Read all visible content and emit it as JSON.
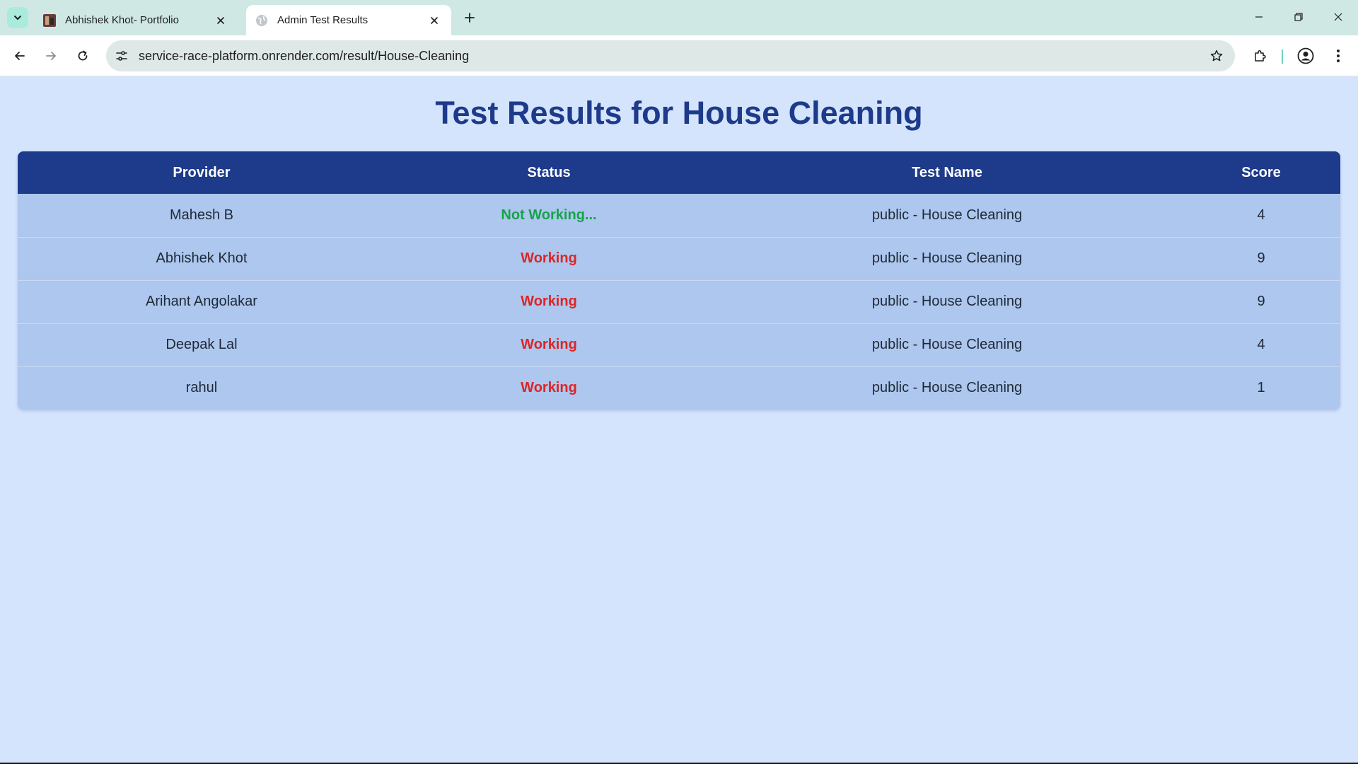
{
  "browser": {
    "tabs": [
      {
        "title": "Abhishek Khot- Portfolio",
        "active": false,
        "icon": "portfolio-favicon"
      },
      {
        "title": "Admin Test Results",
        "active": true,
        "icon": "globe-icon"
      }
    ],
    "url": "service-race-platform.onrender.com/result/House-Cleaning"
  },
  "page": {
    "title": "Test Results for House Cleaning",
    "columns": [
      "Provider",
      "Status",
      "Test Name",
      "Score"
    ],
    "rows": [
      {
        "provider": "Mahesh B",
        "status": "Not Working...",
        "status_color": "#16a34a",
        "test_name": "public - House Cleaning",
        "score": "4"
      },
      {
        "provider": "Abhishek Khot",
        "status": "Working",
        "status_color": "#dc2626",
        "test_name": "public - House Cleaning",
        "score": "9"
      },
      {
        "provider": "Arihant Angolakar",
        "status": "Working",
        "status_color": "#dc2626",
        "test_name": "public - House Cleaning",
        "score": "9"
      },
      {
        "provider": "Deepak Lal",
        "status": "Working",
        "status_color": "#dc2626",
        "test_name": "public - House Cleaning",
        "score": "4"
      },
      {
        "provider": "rahul",
        "status": "Working",
        "status_color": "#dc2626",
        "test_name": "public - House Cleaning",
        "score": "1"
      }
    ]
  },
  "colors": {
    "header_bg": "#1e3a8a",
    "row_bg": "#adc7ee",
    "page_bg": "#d4e4fd"
  }
}
